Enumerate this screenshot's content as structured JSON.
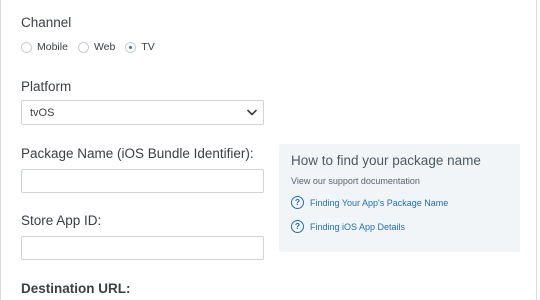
{
  "channel": {
    "label": "Channel",
    "options": [
      {
        "label": "Mobile",
        "checked": false
      },
      {
        "label": "Web",
        "checked": false
      },
      {
        "label": "TV",
        "checked": true
      }
    ]
  },
  "platform": {
    "label": "Platform",
    "value": "tvOS",
    "chevron_icon": "chevron-down-icon"
  },
  "package_name": {
    "label": "Package Name (iOS Bundle Identifier):",
    "value": ""
  },
  "store_app_id": {
    "label": "Store App ID:",
    "value": ""
  },
  "destination_url": {
    "label": "Destination URL:"
  },
  "help": {
    "title": "How to find your package name",
    "subtitle": "View our support documentation",
    "links": [
      {
        "label": "Finding Your App's Package Name",
        "icon": "question-circle-icon"
      },
      {
        "label": "Finding iOS App Details",
        "icon": "question-circle-icon"
      }
    ]
  },
  "colors": {
    "link": "#1f6fb5",
    "radio_selected": "#1f7bc4",
    "panel_bg": "#f2f5f8",
    "border": "#cfd4d9"
  }
}
